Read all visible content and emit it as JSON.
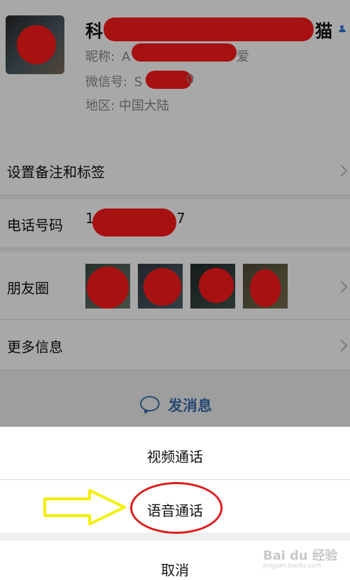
{
  "profile": {
    "name_first_char": "科",
    "name_last_char": "猫",
    "nickname_label": "昵称:",
    "nickname_start": "A",
    "nickname_end": "爱",
    "wechat_id_label": "微信号:",
    "wechat_id_start": "S",
    "wechat_id_end": "0",
    "region_label": "地区:",
    "region_value": "中国大陆"
  },
  "rows": {
    "remark_label": "设置备注和标签",
    "phone_label": "电话号码",
    "phone_value_start": "1",
    "phone_value_end": "7",
    "moments_label": "朋友圈",
    "more_info_label": "更多信息"
  },
  "send_message_label": "发消息",
  "action_sheet": {
    "video_call": "视频通话",
    "voice_call": "语音通话",
    "cancel": "取消"
  },
  "watermark": {
    "brand": "Bai du 经验",
    "url": "jingyan.baidu.com"
  },
  "colors": {
    "redaction": "#ff1b1b",
    "link_blue": "#3a6fb0",
    "annotation_red": "#e01a1a",
    "annotation_yellow": "#f4f000"
  }
}
